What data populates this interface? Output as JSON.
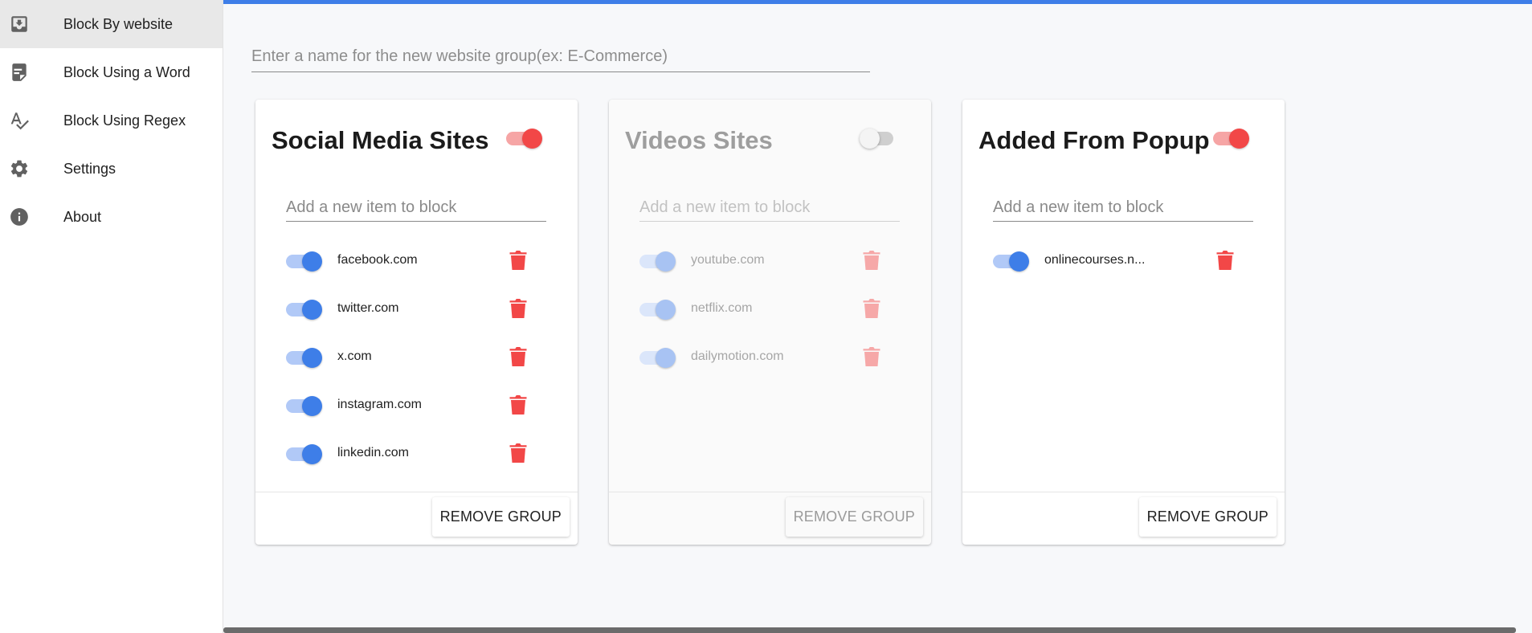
{
  "sidebar": {
    "items": [
      {
        "label": "Block By website",
        "icon": "download-box-icon",
        "active": true
      },
      {
        "label": "Block Using a Word",
        "icon": "note-text-icon",
        "active": false
      },
      {
        "label": "Block Using Regex",
        "icon": "spellcheck-icon",
        "active": false
      },
      {
        "label": "Settings",
        "icon": "gear-icon",
        "active": false
      },
      {
        "label": "About",
        "icon": "info-icon",
        "active": false
      }
    ]
  },
  "main": {
    "group_name_placeholder": "Enter a name for the new website group(ex: E-Commerce)",
    "accent_color": "#3e7ee8",
    "delete_color": "#f24747"
  },
  "groups": [
    {
      "title": "Social Media Sites",
      "enabled": true,
      "add_placeholder": "Add a new item to block",
      "remove_label": "REMOVE GROUP",
      "items": [
        {
          "label": "facebook.com",
          "enabled": true
        },
        {
          "label": "twitter.com",
          "enabled": true
        },
        {
          "label": "x.com",
          "enabled": true
        },
        {
          "label": "instagram.com",
          "enabled": true
        },
        {
          "label": "linkedin.com",
          "enabled": true
        }
      ]
    },
    {
      "title": "Videos Sites",
      "enabled": false,
      "add_placeholder": "Add a new item to block",
      "remove_label": "REMOVE GROUP",
      "items": [
        {
          "label": "youtube.com",
          "enabled": true
        },
        {
          "label": "netflix.com",
          "enabled": true
        },
        {
          "label": "dailymotion.com",
          "enabled": true
        }
      ]
    },
    {
      "title": "Added From Popup",
      "enabled": true,
      "add_placeholder": "Add a new item to block",
      "remove_label": "REMOVE GROUP",
      "items": [
        {
          "label": "onlinecourses.n...",
          "enabled": true
        }
      ]
    }
  ]
}
